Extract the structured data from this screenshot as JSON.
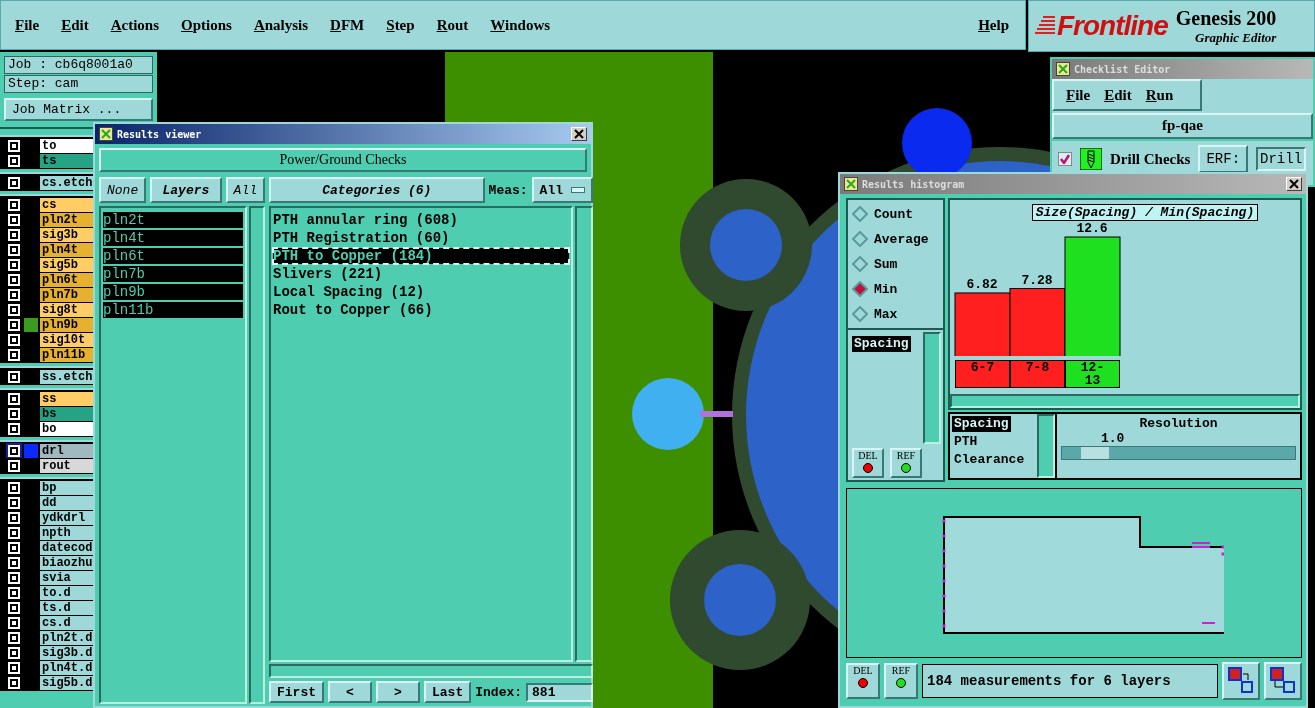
{
  "menu_bar": {
    "items": [
      "File",
      "Edit",
      "Actions",
      "Options",
      "Analysis",
      "DFM",
      "Step",
      "Rout",
      "Windows"
    ],
    "help": "Help"
  },
  "logo": {
    "brand": "Frontline",
    "product": "Genesis 200",
    "subtitle": "Graphic Editor"
  },
  "job_panel": {
    "job": "Job : cb6q8001a0",
    "step": "Step: cam",
    "matrix_button": "Job Matrix ..."
  },
  "layer_groups": [
    {
      "layers": [
        {
          "name": "to",
          "color": "#ffffff",
          "selected": false
        },
        {
          "name": "ts",
          "color": "#26a384",
          "selected": false
        }
      ]
    },
    {
      "layers": [
        {
          "name": "cs.etch",
          "color": "#9ed8d8",
          "selected": false
        }
      ]
    },
    {
      "layers": [
        {
          "name": "cs",
          "color": "#ffcc66",
          "selected": false
        },
        {
          "name": "pln2t",
          "color": "#e6b030",
          "selected": false
        },
        {
          "name": "sig3b",
          "color": "#ffcc66",
          "selected": false
        },
        {
          "name": "pln4t",
          "color": "#e6b030",
          "selected": false
        },
        {
          "name": "sig5b",
          "color": "#ffcc66",
          "selected": false
        },
        {
          "name": "pln6t",
          "color": "#e6b030",
          "selected": false
        },
        {
          "name": "pln7b",
          "color": "#e6b030",
          "selected": false
        },
        {
          "name": "sig8t",
          "color": "#ffcc66",
          "selected": false
        },
        {
          "name": "pln9b",
          "color": "#e6b030",
          "swatch": {
            "color": "#3c9a1e"
          },
          "selected": false
        },
        {
          "name": "sig10t",
          "color": "#ffcc66",
          "selected": false
        },
        {
          "name": "pln11b",
          "color": "#e6b030",
          "selected": false
        }
      ]
    },
    {
      "layers": [
        {
          "name": "ss.etch",
          "color": "#9ed8d8",
          "selected": false
        }
      ]
    },
    {
      "layers": [
        {
          "name": "ss",
          "color": "#ffcc66",
          "selected": false
        },
        {
          "name": "bs",
          "color": "#26a384",
          "selected": false
        },
        {
          "name": "bo",
          "color": "#ffffff",
          "selected": false
        }
      ]
    },
    {
      "layers": [
        {
          "name": "drl",
          "color": "#a0b8c0",
          "swatch": {
            "color": "#0a2aff"
          },
          "selected": true
        },
        {
          "name": "rout",
          "color": "#d8d8d8",
          "selected": false
        }
      ]
    },
    {
      "layers": [
        {
          "name": "bp",
          "color": "#9ed8d8",
          "selected": false
        },
        {
          "name": "dd",
          "color": "#9ed8d8",
          "selected": false
        },
        {
          "name": "ydkdrl",
          "color": "#9ed8d8",
          "selected": false
        },
        {
          "name": "npth",
          "color": "#9ed8d8",
          "selected": false
        },
        {
          "name": "datecod",
          "color": "#9ed8d8",
          "selected": false
        },
        {
          "name": "biaozhu",
          "color": "#9ed8d8",
          "selected": false
        },
        {
          "name": "svia",
          "color": "#9ed8d8",
          "selected": false
        },
        {
          "name": "to.d",
          "color": "#9ed8d8",
          "selected": false
        },
        {
          "name": "ts.d",
          "color": "#9ed8d8",
          "selected": false
        },
        {
          "name": "cs.d",
          "color": "#9ed8d8",
          "selected": false
        },
        {
          "name": "pln2t.d",
          "color": "#9ed8d8",
          "selected": false
        },
        {
          "name": "sig3b.d",
          "color": "#9ed8d8",
          "selected": false
        },
        {
          "name": "pln4t.d",
          "color": "#9ed8d8",
          "selected": false
        },
        {
          "name": "sig5b.d",
          "color": "#9ed8d8",
          "selected": false
        }
      ]
    }
  ],
  "results_viewer": {
    "title": "Results viewer",
    "header": "Power/Ground Checks",
    "none_button": "None",
    "layers_button": "Layers",
    "all_button": "All",
    "layers": [
      {
        "name": "pln2t",
        "selected": true
      },
      {
        "name": "pln4t",
        "selected": true
      },
      {
        "name": "pln6t",
        "selected": true
      },
      {
        "name": "pln7b",
        "selected": true
      },
      {
        "name": "pln9b",
        "selected": true
      },
      {
        "name": "pln11b",
        "selected": true
      }
    ],
    "categories_button": "Categories (6)",
    "meas_label": "Meas:",
    "meas_value": "All",
    "categories": [
      {
        "label": "PTH annular ring (608)",
        "selected": false
      },
      {
        "label": "PTH Registration (60)",
        "selected": false
      },
      {
        "label": "PTH to Copper (184)",
        "selected": true
      },
      {
        "label": "Slivers (221)",
        "selected": false
      },
      {
        "label": "Local Spacing (12)",
        "selected": false
      },
      {
        "label": "Rout to Copper (66)",
        "selected": false
      }
    ],
    "nav_buttons": [
      "First",
      "<",
      ">",
      "Last"
    ],
    "index_label": "Index:",
    "index_value": "881"
  },
  "checklist_editor": {
    "title": "Checklist Editor",
    "menu": [
      "File",
      "Edit",
      "Run"
    ],
    "checklist": "fp-qae",
    "rows": [
      {
        "checked": true,
        "name": "Drill Checks",
        "erf_label": "ERF:",
        "erf_value": "Drill"
      }
    ]
  },
  "histogram": {
    "title": "Results histogram",
    "modes": [
      {
        "label": "Count",
        "selected": false
      },
      {
        "label": "Average",
        "selected": false
      },
      {
        "label": "Sum",
        "selected": false
      },
      {
        "label": "Min",
        "selected": true
      },
      {
        "label": "Max",
        "selected": false
      }
    ],
    "measures": [
      {
        "label": "Spacing",
        "selected": true
      }
    ],
    "measure_buttons": [
      "DEL",
      "REF"
    ],
    "chart_data": {
      "type": "bar",
      "title": "Size(Spacing) / Min(Spacing)",
      "categories": [
        "6-7",
        "7-8",
        "12-13"
      ],
      "values": [
        6.82,
        7.28,
        12.6
      ],
      "data_labels": true
    },
    "bins": [
      {
        "color": "#ff1f1f"
      },
      {
        "color": "#ff1f1f"
      },
      {
        "color": "#1fe01f"
      }
    ],
    "attributes": [
      {
        "label": "Spacing",
        "selected": true
      },
      {
        "label": "PTH",
        "selected": false
      },
      {
        "label": "Clearance",
        "selected": false
      }
    ],
    "resolution_label": "Resolution",
    "resolution_value": "1.0",
    "resolution_slider": {
      "level": 0.08
    },
    "footer_buttons": [
      "DEL",
      "REF"
    ],
    "status": "184 measurements for 6 layers"
  }
}
